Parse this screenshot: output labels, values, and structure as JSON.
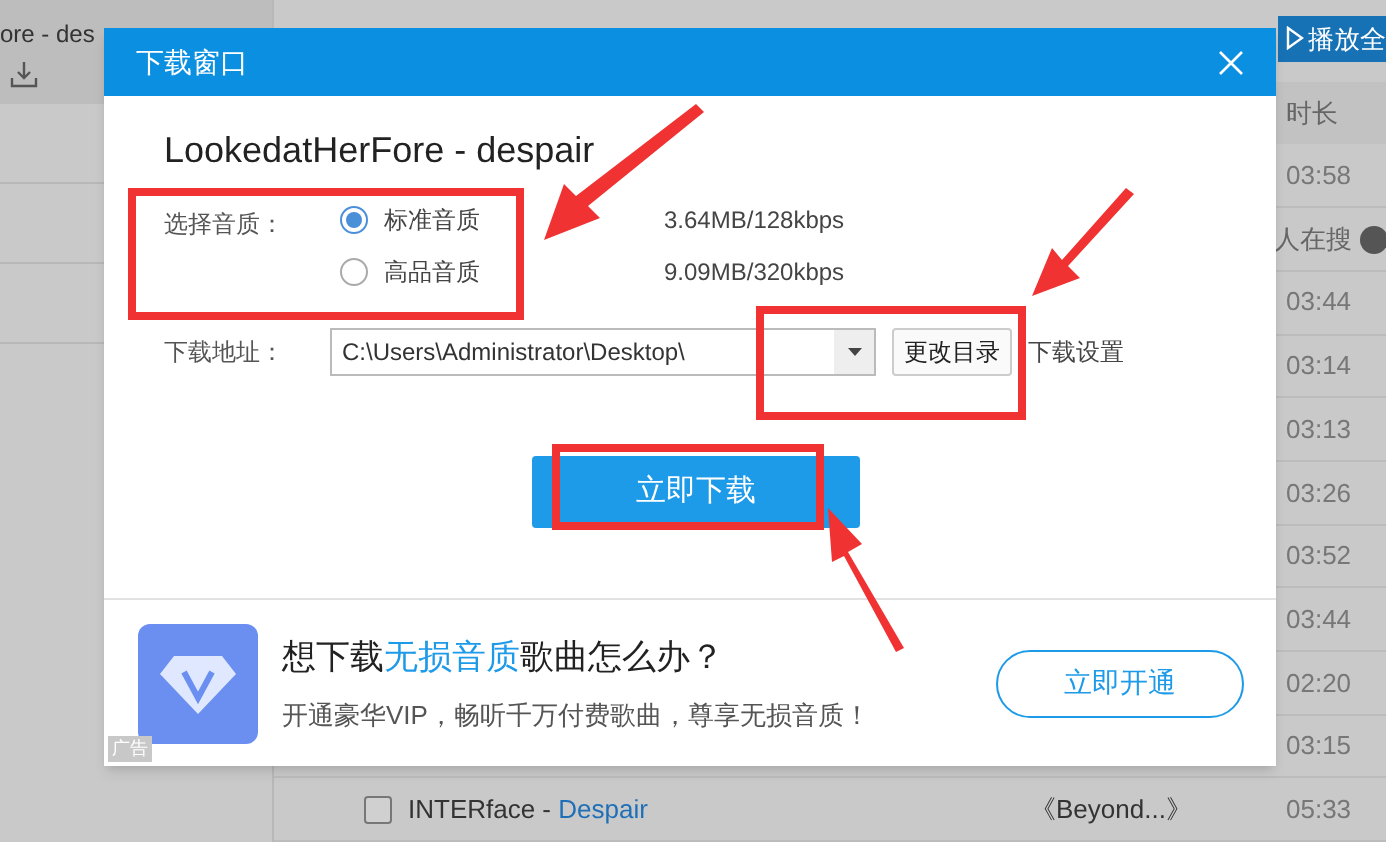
{
  "sidebar": {
    "items": [
      {
        "label": "ore - des",
        "selected": true
      }
    ]
  },
  "toolbar": {
    "play_all": "播放全"
  },
  "list": {
    "header": "时长",
    "rows": [
      {
        "kind": "duration",
        "text": "03:58"
      },
      {
        "kind": "search",
        "text": "人在搜"
      },
      {
        "kind": "duration",
        "text": "03:44"
      },
      {
        "kind": "duration",
        "text": "03:14"
      },
      {
        "kind": "duration",
        "text": "03:13"
      },
      {
        "kind": "duration",
        "text": "03:26"
      },
      {
        "kind": "duration",
        "text": "03:52"
      },
      {
        "kind": "duration",
        "text": "03:44"
      },
      {
        "kind": "duration",
        "text": "02:20"
      },
      {
        "kind": "duration",
        "text": "03:15"
      },
      {
        "kind": "track",
        "title": "INTERface - ",
        "artist": "Despair",
        "album": "《Beyond...》",
        "text": "05:33",
        "checked": false
      }
    ]
  },
  "dialog": {
    "title": "下载窗口",
    "song": "LookedatHerFore - despair",
    "quality_label": "选择音质：",
    "options": [
      {
        "label": "标准音质",
        "info": "3.64MB/128kbps",
        "selected": true
      },
      {
        "label": "高品音质",
        "info": "9.09MB/320kbps",
        "selected": false
      }
    ],
    "path_label": "下载地址：",
    "path": "C:\\Users\\Administrator\\Desktop\\",
    "change_dir": "更改目录",
    "settings": "下载设置",
    "download": "立即下载",
    "ad": {
      "headline": [
        {
          "text": "想下载",
          "highlight": false
        },
        {
          "text": "无损音质",
          "highlight": true
        },
        {
          "text": "歌曲怎么办？",
          "highlight": false
        }
      ],
      "subtitle": "开通豪华VIP，畅听千万付费歌曲，尊享无损音质！",
      "button": "立即开通",
      "label": "广告"
    }
  }
}
